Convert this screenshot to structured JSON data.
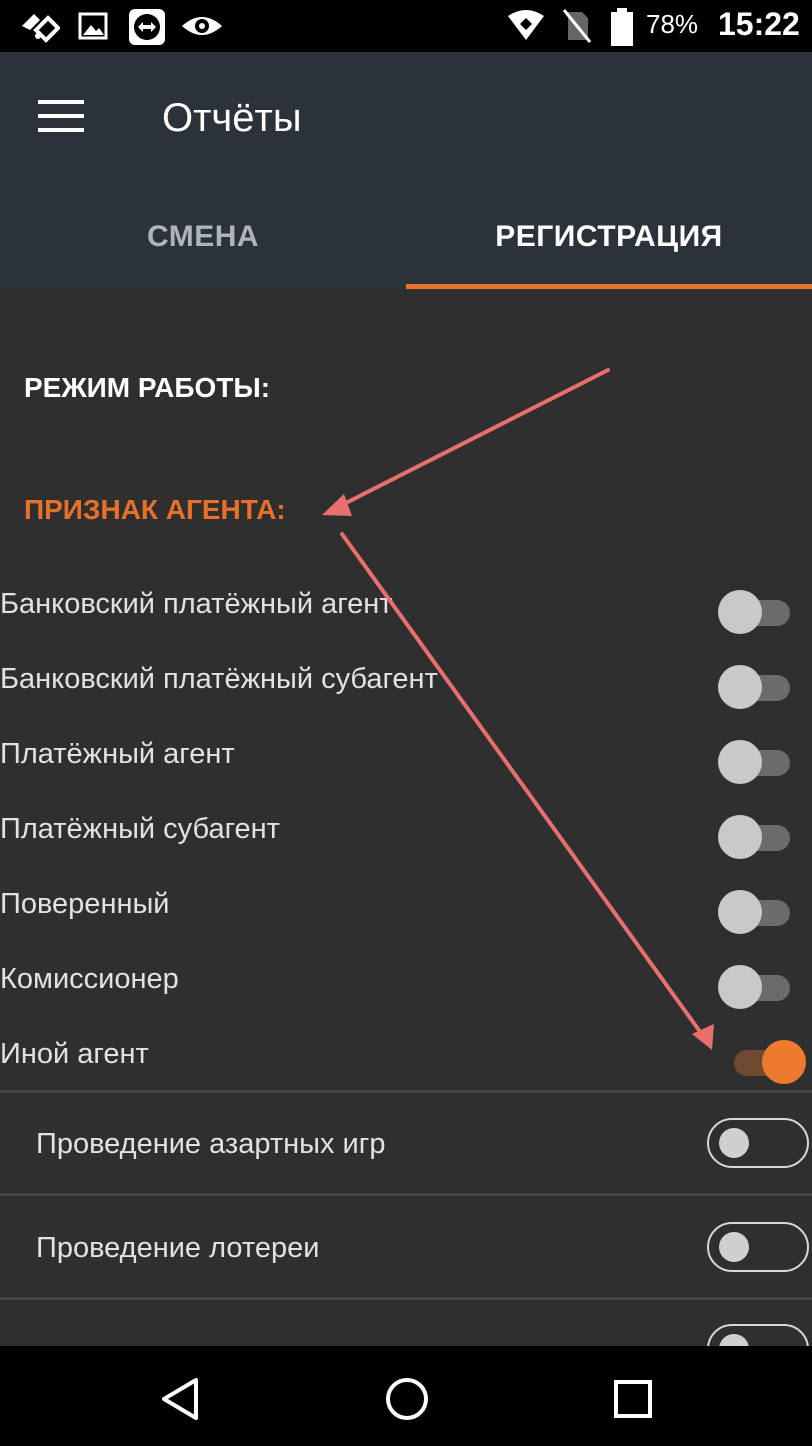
{
  "status_bar": {
    "icons": [
      "app-diamond-icon",
      "image-icon",
      "teamviewer-icon",
      "eye-icon",
      "wifi-icon",
      "no-sim-icon",
      "battery-icon"
    ],
    "battery": "78%",
    "time": "15:22"
  },
  "app_bar": {
    "title": "Отчёты",
    "menu_icon": "hamburger-menu-icon"
  },
  "tabs": [
    {
      "label": "СМЕНА",
      "selected": false
    },
    {
      "label": "РЕГИСТРАЦИЯ",
      "selected": true
    }
  ],
  "accent_color": "#e8712a",
  "sections": {
    "mode": "РЕЖИМ РАБОТЫ:",
    "agent": "ПРИЗНАК АГЕНТА:"
  },
  "agent_toggles": [
    {
      "label": "Банковский платёжный агент",
      "on": false
    },
    {
      "label": "Банковский платёжный субагент",
      "on": false
    },
    {
      "label": "Платёжный агент",
      "on": false
    },
    {
      "label": "Платёжный субагент",
      "on": false
    },
    {
      "label": "Поверенный",
      "on": false
    },
    {
      "label": "Комиссионер",
      "on": false
    },
    {
      "label": "Иной агент",
      "on": true
    }
  ],
  "sub_toggles": [
    {
      "label": "Проведение азартных игр",
      "on": false
    },
    {
      "label": "Проведение лотереи",
      "on": false
    }
  ],
  "nav_bar": {
    "icons": [
      "back-triangle-icon",
      "home-circle-icon",
      "recents-square-icon"
    ]
  }
}
